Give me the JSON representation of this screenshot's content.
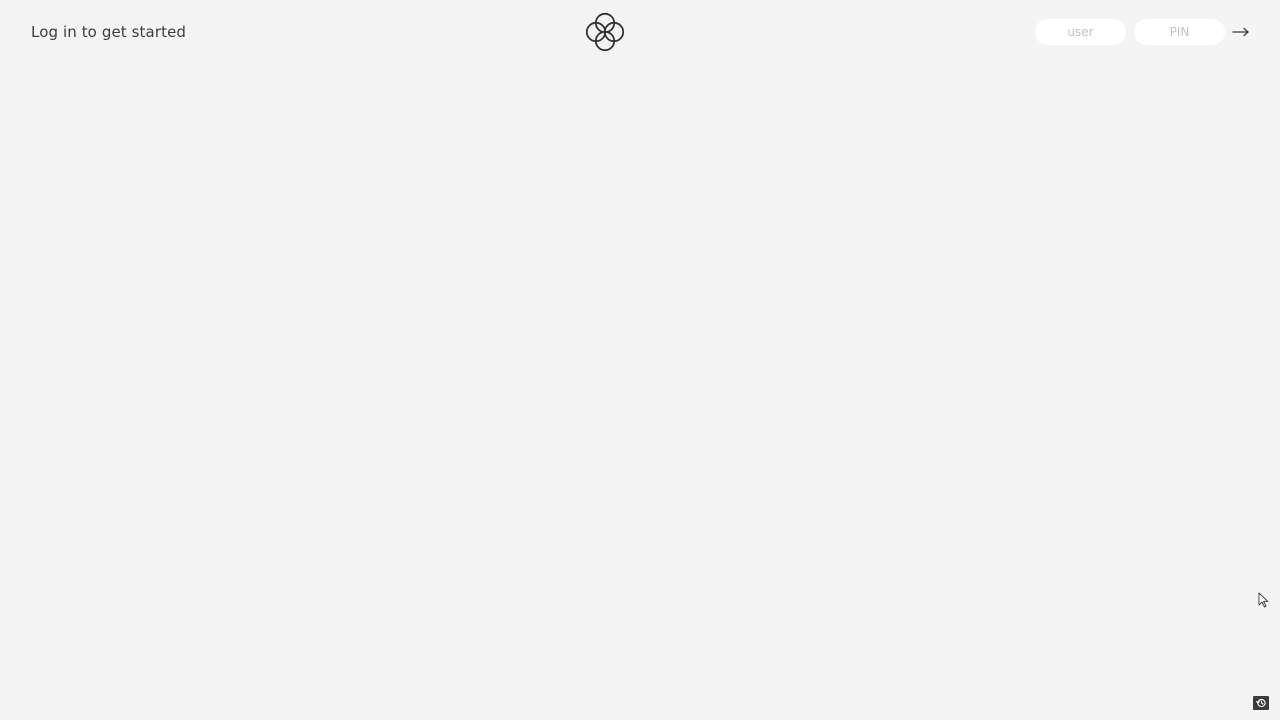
{
  "header": {
    "login_prompt": "Log in to get started"
  },
  "login_form": {
    "user_placeholder": "user",
    "pin_placeholder": "PIN"
  },
  "icons": {
    "logo": "four-ring-flower-logo",
    "submit": "arrow-right-icon",
    "cursor": "mouse-pointer-icon",
    "corner": "history-icon"
  },
  "colors": {
    "background": "#f4f4f4",
    "text": "#3d3d3d",
    "input_background": "#ffffff",
    "placeholder": "#c2c2c2"
  }
}
